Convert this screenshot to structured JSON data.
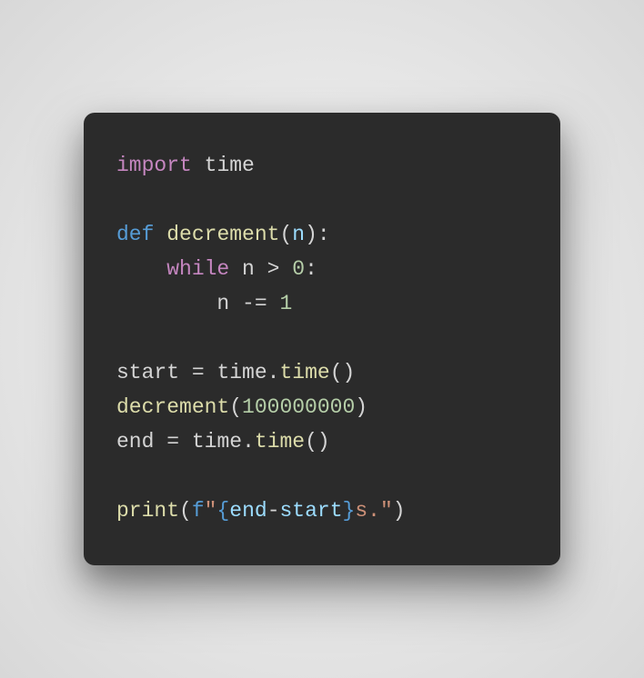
{
  "code": {
    "line1": {
      "import": "import",
      "module": "time"
    },
    "line3": {
      "def": "def",
      "fname": "decrement",
      "lparen": "(",
      "param": "n",
      "rparen": ")",
      "colon": ":"
    },
    "line4": {
      "indent": "    ",
      "while": "while",
      "var": "n",
      "op": ">",
      "zero": "0",
      "colon": ":"
    },
    "line5": {
      "indent": "        ",
      "var": "n",
      "op": "-=",
      "one": "1"
    },
    "line7": {
      "var": "start",
      "eq": "=",
      "mod": "time",
      "dot": ".",
      "fn": "time",
      "parens": "()"
    },
    "line8": {
      "fn": "decrement",
      "lparen": "(",
      "arg": "100000000",
      "rparen": ")"
    },
    "line9": {
      "var": "end",
      "eq": "=",
      "mod": "time",
      "dot": ".",
      "fn": "time",
      "parens": "()"
    },
    "line11": {
      "fn": "print",
      "lparen": "(",
      "prefix": "f",
      "q1": "\"",
      "lbrace": "{",
      "expr1": "end",
      "minus": "-",
      "expr2": "start",
      "rbrace": "}",
      "literal": "s.",
      "q2": "\"",
      "rparen": ")"
    }
  }
}
